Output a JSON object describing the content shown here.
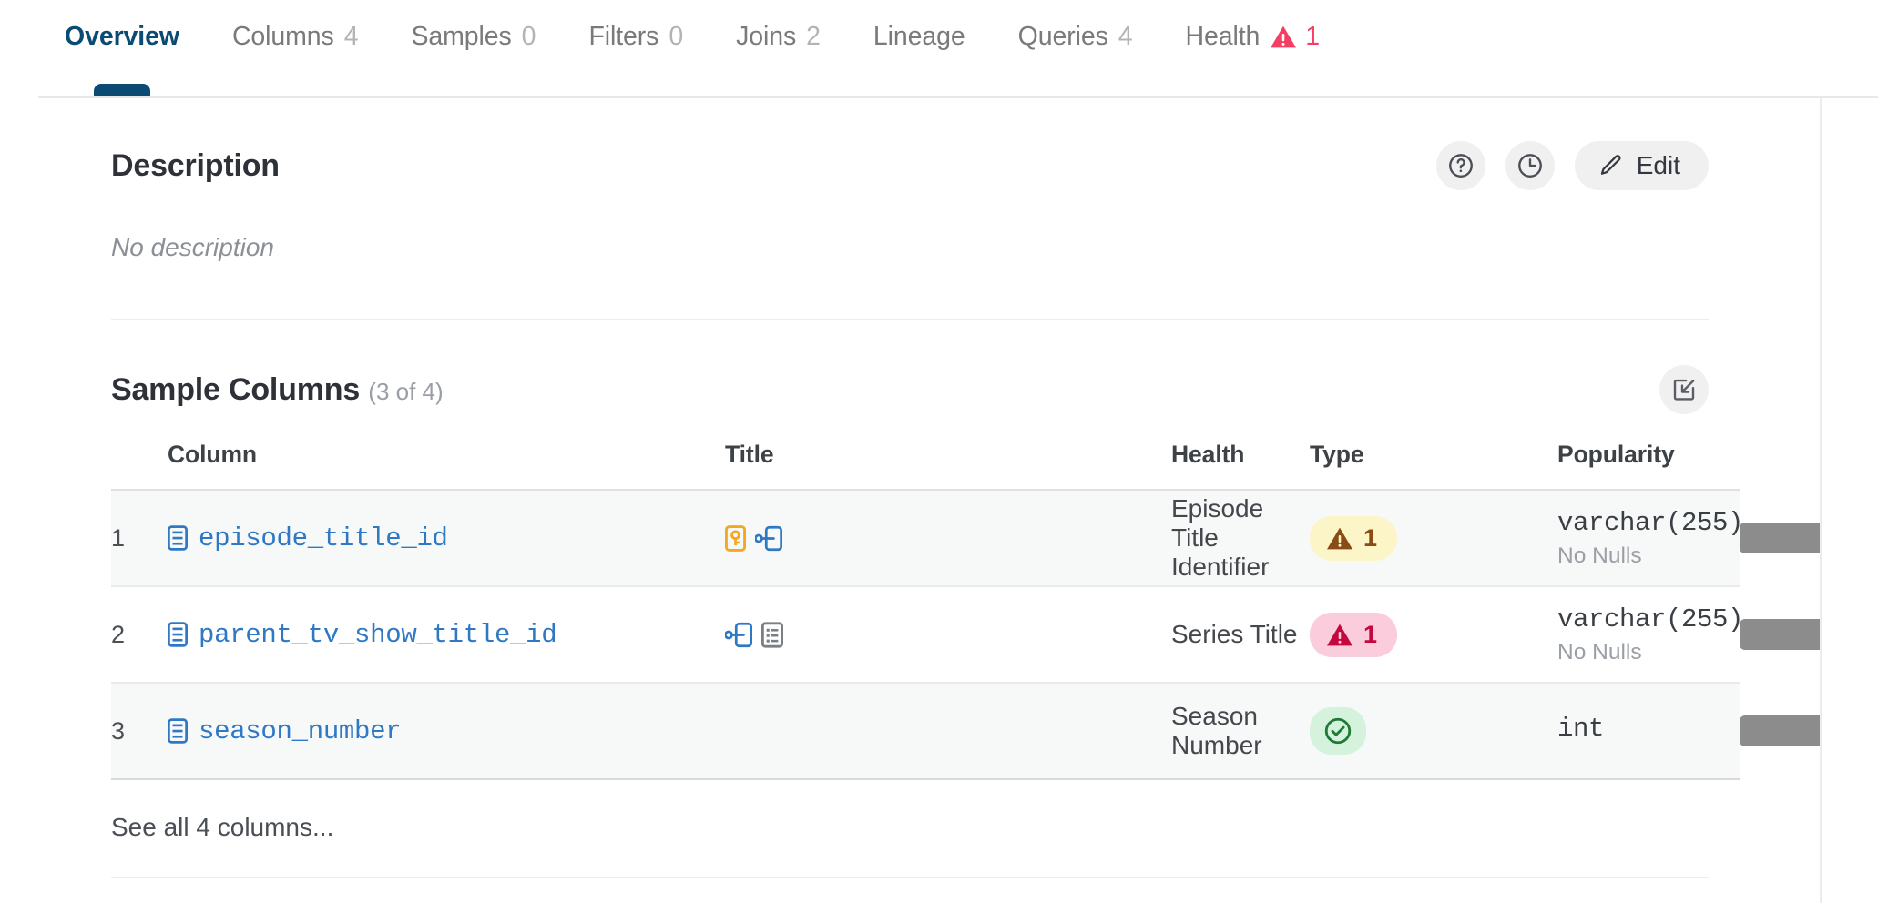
{
  "tabs": [
    {
      "label": "Overview",
      "count": "",
      "active": true
    },
    {
      "label": "Columns",
      "count": "4",
      "active": false
    },
    {
      "label": "Samples",
      "count": "0",
      "active": false
    },
    {
      "label": "Filters",
      "count": "0",
      "active": false
    },
    {
      "label": "Joins",
      "count": "2",
      "active": false
    },
    {
      "label": "Lineage",
      "count": "",
      "active": false
    },
    {
      "label": "Queries",
      "count": "4",
      "active": false
    },
    {
      "label": "Health",
      "count": "1",
      "active": false,
      "warn": true
    }
  ],
  "description": {
    "heading": "Description",
    "body": "No description",
    "help_icon": "question-circle-icon",
    "history_icon": "clock-icon",
    "edit_label": "Edit",
    "edit_icon": "pencil-icon"
  },
  "sample_columns": {
    "heading": "Sample Columns",
    "count_label": "(3 of 4)",
    "action_icon": "open-in-panel-icon",
    "headers": {
      "column": "Column",
      "title": "Title",
      "health": "Health",
      "type": "Type",
      "popularity": "Popularity"
    },
    "rows": [
      {
        "index": "1",
        "name": "episode_title_id",
        "badges": [
          "primary-key-icon",
          "foreign-key-icon"
        ],
        "title": "Episode Title Identifier",
        "health_state": "warn",
        "health_count": "1",
        "type": "varchar(255)",
        "type_note": "No Nulls",
        "popularity": 100
      },
      {
        "index": "2",
        "name": "parent_tv_show_title_id",
        "badges": [
          "foreign-key-icon",
          "description-icon"
        ],
        "title": "Series Title",
        "health_state": "err",
        "health_count": "1",
        "type": "varchar(255)",
        "type_note": "No Nulls",
        "popularity": 100
      },
      {
        "index": "3",
        "name": "season_number",
        "badges": [],
        "title": "Season Number",
        "health_state": "ok",
        "health_count": "",
        "type": "int",
        "type_note": "",
        "popularity": 100
      }
    ],
    "see_all": "See all 4 columns..."
  },
  "colors": {
    "active_tab": "#0b4a72",
    "link": "#2f78c4",
    "warn_bg": "#fcf5c8",
    "warn_fg": "#8a4b14",
    "error_bg": "#fbccdb",
    "error_fg": "#c4083f",
    "ok_bg": "#d5f2dc",
    "ok_fg": "#1e7a37",
    "health_tab_warn": "#f43f63",
    "primary_key": "#f5a623",
    "popularity_bar": "#8c8c8c"
  }
}
